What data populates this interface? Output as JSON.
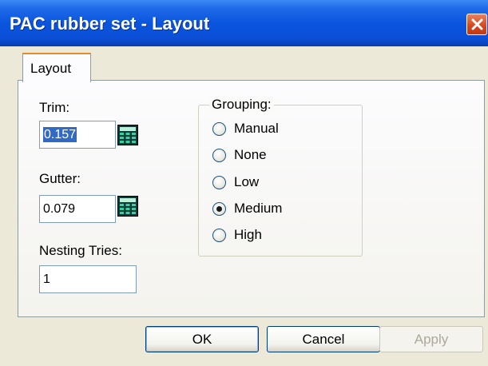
{
  "window": {
    "title": "PAC rubber set - Layout"
  },
  "tabs": [
    {
      "label": "Layout",
      "active": true
    }
  ],
  "trim": {
    "label": "Trim:",
    "value": "0.157",
    "calculator_icon": "calculator-icon"
  },
  "gutter": {
    "label": "Gutter:",
    "value": "0.079",
    "calculator_icon": "calculator-icon"
  },
  "nesting": {
    "label": "Nesting Tries:",
    "value": "1"
  },
  "grouping": {
    "legend": "Grouping:",
    "options": [
      {
        "label": "Manual",
        "selected": false
      },
      {
        "label": "None",
        "selected": false
      },
      {
        "label": "Low",
        "selected": false
      },
      {
        "label": "Medium",
        "selected": true
      },
      {
        "label": "High",
        "selected": false
      }
    ]
  },
  "buttons": {
    "ok": "OK",
    "cancel": "Cancel",
    "apply": "Apply"
  },
  "colors": {
    "title_bar": "#0a55de",
    "dialog_bg": "#ece9d8",
    "selection": "#316ac5",
    "close_button": "#d4461d"
  }
}
